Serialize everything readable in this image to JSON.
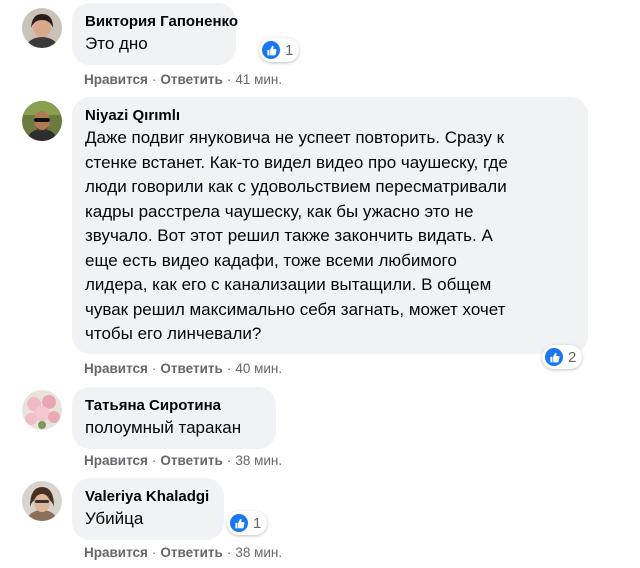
{
  "colors": {
    "bubble": "#f0f2f5",
    "meta_text": "#65676b",
    "like_blue": "#1877f2"
  },
  "separator": "·",
  "comments": [
    {
      "author": "Виктория Гапоненко",
      "text": "Это дно",
      "reactions": "1",
      "reaction_icon": "like-icon",
      "actions": {
        "like": "Нравится",
        "reply": "Ответить",
        "time": "41 мин."
      }
    },
    {
      "author": "Niyazi Qırımlı",
      "text": "Даже подвиг януковича не успеет повторить. Сразу к\nстенке встанет. Как-то видел видео про чаушеску, где\nлюди говорили как с удовольствием пересматривали\nкадры расстрела чаушеску, как бы ужасно это не\nзвучало. Вот этот решил также закончить видать. А\nеще есть видео кадафи, тоже всеми любимого\nлидера, как его с канализации вытащили. В общем\nчувак решил максимально себя загнать, может хочет\nчтобы его линчевали?",
      "reactions": "2",
      "reaction_icon": "like-icon",
      "actions": {
        "like": "Нравится",
        "reply": "Ответить",
        "time": "40 мин."
      }
    },
    {
      "author": "Татьяна Сиротина",
      "text": "полоумный таракан",
      "actions": {
        "like": "Нравится",
        "reply": "Ответить",
        "time": "38 мин."
      }
    },
    {
      "author": "Valeriya Khaladgi",
      "text": "Убийца",
      "reactions": "1",
      "reaction_icon": "like-icon",
      "actions": {
        "like": "Нравится",
        "reply": "Ответить",
        "time": "38 мин."
      }
    }
  ]
}
